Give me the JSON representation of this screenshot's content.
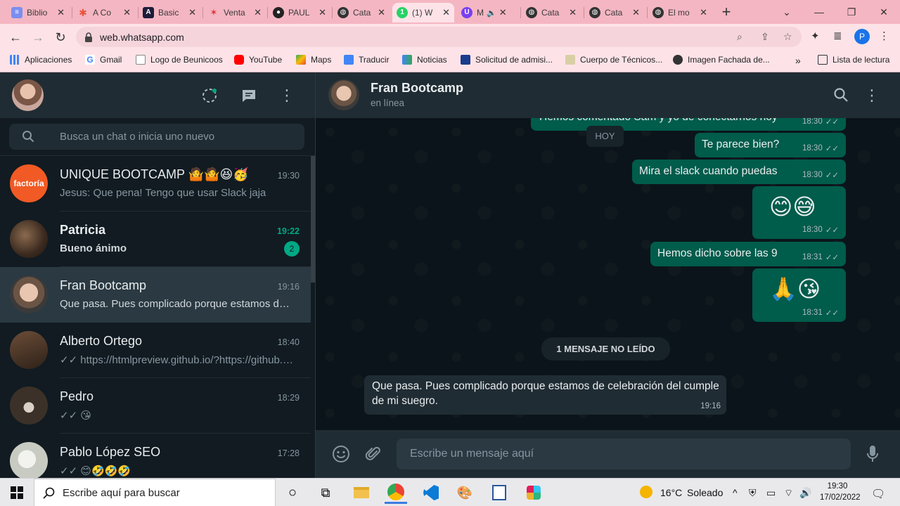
{
  "browser": {
    "tabs": [
      {
        "title": "Biblio",
        "color": "#7b8ef0"
      },
      {
        "title": "A Co",
        "color": "#e8553e"
      },
      {
        "title": "Basic",
        "color": "#1c1c3a"
      },
      {
        "title": "Venta",
        "color": "#d33"
      },
      {
        "title": "PAUL",
        "color": "#222"
      },
      {
        "title": "Cata",
        "color": "#333"
      },
      {
        "title": "(1) W",
        "color": "#25d366"
      },
      {
        "title": "M",
        "color": "#7a3ff1"
      },
      {
        "title": "Cata",
        "color": "#333"
      },
      {
        "title": "Cata",
        "color": "#333"
      },
      {
        "title": "El mo",
        "color": "#333"
      }
    ],
    "url": "web.whatsapp.com",
    "profile_letter": "P",
    "bookmarks": [
      "Aplicaciones",
      "Gmail",
      "Logo de Beunicoos",
      "YouTube",
      "Maps",
      "Traducir",
      "Noticias",
      "Solicitud de admisi...",
      "Cuerpo de Técnicos...",
      "Imagen Fachada de..."
    ],
    "reading_list": "Lista de lectura"
  },
  "whatsapp": {
    "search_placeholder": "Busca un chat o inicia uno nuevo",
    "chats": [
      {
        "name": "UNIQUE BOOTCAMP 🤷🤷😆🥳",
        "time": "19:30",
        "message": "Jesus: Que pena! Tengo que usar Slack jaja",
        "avatar_text": "factoría"
      },
      {
        "name": "Patricia",
        "time": "19:22",
        "message": "Bueno ánimo",
        "unread": "2"
      },
      {
        "name": "Fran Bootcamp",
        "time": "19:16",
        "message": "Que pasa. Pues complicado porque estamos de celebración del cumple de mi suegro."
      },
      {
        "name": "Alberto Ortego",
        "time": "18:40",
        "message": "✓✓ https://htmlpreview.github.io/?https://github.com"
      },
      {
        "name": "Pedro",
        "time": "18:29",
        "message": "✓✓ 😘"
      },
      {
        "name": "Pablo López SEO",
        "time": "17:28",
        "message": "✓✓ 😊🤣🤣🤣"
      }
    ],
    "contact": {
      "name": "Fran Bootcamp",
      "status": "en línea"
    },
    "day_label": "HOY",
    "messages": [
      {
        "text": "Hemos comentado Sam y yo de conectarnos hoy",
        "time": "18:30"
      },
      {
        "text": "Te parece bien?",
        "time": "18:30"
      },
      {
        "text": "Mira el slack cuando puedas",
        "time": "18:30"
      },
      {
        "text": "😊😅",
        "time": "18:30"
      },
      {
        "text": "Hemos dicho sobre las 9",
        "time": "18:31"
      },
      {
        "text": "🙏😘",
        "time": "18:31"
      }
    ],
    "unread_label": "1 MENSAJE NO LEÍDO",
    "incoming": {
      "line1": "Que pasa. Pues complicado porque estamos de celebración del cumple",
      "line2": "de mi suegro.",
      "time": "19:16"
    },
    "composer_placeholder": "Escribe un mensaje aquí"
  },
  "taskbar": {
    "search_placeholder": "Escribe aquí para buscar",
    "weather_temp": "16°C",
    "weather_text": "Soleado",
    "time": "19:30",
    "date": "17/02/2022"
  },
  "colors": {
    "wa_green": "#00a884",
    "out_bubble": "#005c4b",
    "in_bubble": "#202c33",
    "panel": "#202c33"
  }
}
